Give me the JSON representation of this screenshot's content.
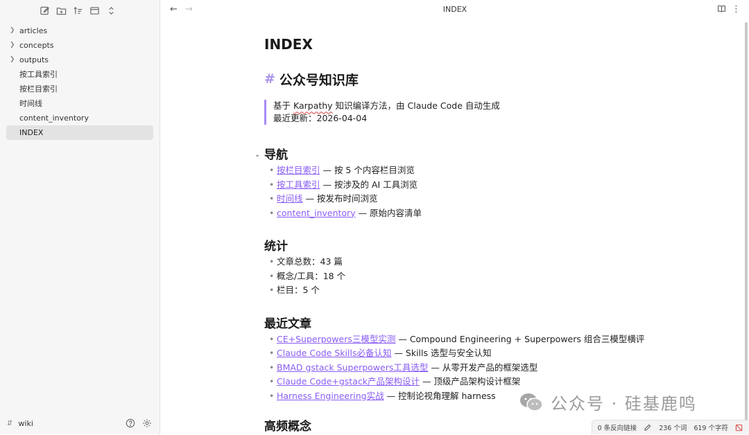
{
  "sidebar": {
    "items": [
      {
        "label": "articles",
        "type": "folder"
      },
      {
        "label": "concepts",
        "type": "folder"
      },
      {
        "label": "outputs",
        "type": "folder"
      },
      {
        "label": "按工具索引",
        "type": "file"
      },
      {
        "label": "按栏目索引",
        "type": "file"
      },
      {
        "label": "时间线",
        "type": "file"
      },
      {
        "label": "content_inventory",
        "type": "file"
      },
      {
        "label": "INDEX",
        "type": "file",
        "active": true
      }
    ],
    "vault_name": "wiki"
  },
  "tab": {
    "title": "INDEX"
  },
  "doc": {
    "title": "INDEX",
    "h1": "公众号知识库",
    "quote": {
      "line1_prefix": "基于 ",
      "line1_word": "Karpathy",
      "line1_suffix": " 知识编译方法，由 Claude Code 自动生成",
      "line2": "最近更新：2026-04-04"
    },
    "nav": {
      "heading": "导航",
      "items": [
        {
          "link": "按栏目索引",
          "desc": " — 按 5 个内容栏目浏览"
        },
        {
          "link": "按工具索引",
          "desc": " — 按涉及的 AI 工具浏览"
        },
        {
          "link": "时间线",
          "desc": " — 按发布时间浏览"
        },
        {
          "link": "content_inventory",
          "desc": " — 原始内容清单"
        }
      ]
    },
    "stats": {
      "heading": "统计",
      "items": [
        "文章总数：43 篇",
        "概念/工具：18 个",
        "栏目：5 个"
      ]
    },
    "recent": {
      "heading": "最近文章",
      "items": [
        {
          "link": "CE+Superpowers三模型实测",
          "desc": " — Compound Engineering + Superpowers 组合三模型横评"
        },
        {
          "link": "Claude Code Skills必备认知",
          "desc": " — Skills 选型与安全认知"
        },
        {
          "link": "BMAD gstack Superpowers工具选型",
          "desc": " — 从零开发产品的框架选型"
        },
        {
          "link": "Claude Code+gstack产品架构设计",
          "desc": " — 顶级产品架构设计框架"
        },
        {
          "link": "Harness Engineering实战",
          "desc": " — 控制论视角理解 harness"
        }
      ]
    },
    "partial_heading": "高频概念"
  },
  "watermark": {
    "text": "公众号 · 硅基鹿鸣"
  },
  "status": {
    "backlinks": "0 条反向链接",
    "words": "236 个词",
    "chars": "619 个字符"
  },
  "colors": {
    "accent": "#8a5cf5",
    "quote_bar": "#a88bfa"
  }
}
